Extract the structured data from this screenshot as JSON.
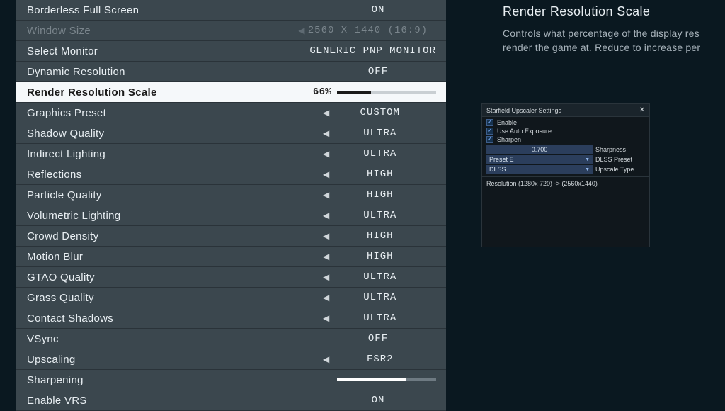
{
  "description": {
    "title": "Render Resolution Scale",
    "body": "Controls what percentage of the display res render the game at. Reduce to increase per"
  },
  "settings": [
    {
      "label": "Borderless Full Screen",
      "type": "simple",
      "value": "ON"
    },
    {
      "label": "Window Size",
      "type": "cycler",
      "value": "2560 X 1440 (16:9)",
      "disabled": true
    },
    {
      "label": "Select Monitor",
      "type": "simple",
      "value": "GENERIC PNP MONITOR"
    },
    {
      "label": "Dynamic Resolution",
      "type": "simple",
      "value": "OFF"
    },
    {
      "label": "Render Resolution Scale",
      "type": "slider",
      "value": "66%",
      "fill": 34,
      "highlighted": true
    },
    {
      "label": "Graphics Preset",
      "type": "cycler",
      "value": "CUSTOM"
    },
    {
      "label": "Shadow Quality",
      "type": "cycler",
      "value": "ULTRA"
    },
    {
      "label": "Indirect Lighting",
      "type": "cycler",
      "value": "ULTRA"
    },
    {
      "label": "Reflections",
      "type": "cycler",
      "value": "HIGH"
    },
    {
      "label": "Particle Quality",
      "type": "cycler",
      "value": "HIGH"
    },
    {
      "label": "Volumetric Lighting",
      "type": "cycler",
      "value": "ULTRA"
    },
    {
      "label": "Crowd Density",
      "type": "cycler",
      "value": "HIGH"
    },
    {
      "label": "Motion Blur",
      "type": "cycler",
      "value": "HIGH"
    },
    {
      "label": "GTAO Quality",
      "type": "cycler",
      "value": "ULTRA"
    },
    {
      "label": "Grass Quality",
      "type": "cycler",
      "value": "ULTRA"
    },
    {
      "label": "Contact Shadows",
      "type": "cycler",
      "value": "ULTRA"
    },
    {
      "label": "VSync",
      "type": "simple",
      "value": "OFF"
    },
    {
      "label": "Upscaling",
      "type": "cycler",
      "value": "FSR2"
    },
    {
      "label": "Sharpening",
      "type": "slider_light",
      "value": "",
      "fill": 70
    },
    {
      "label": "Enable VRS",
      "type": "simple",
      "value": "ON"
    }
  ],
  "overlay": {
    "title": "Starfield Upscaler Settings",
    "checks": [
      {
        "label": "Enable"
      },
      {
        "label": "Use Auto Exposure"
      },
      {
        "label": "Sharpen"
      }
    ],
    "sharpness_value": "0.700",
    "sharpness_label": "Sharpness",
    "preset_value": "Preset E",
    "preset_label": "DLSS Preset",
    "upscale_value": "DLSS",
    "upscale_label": "Upscale Type",
    "resolution_text": "Resolution (1280x 720) -> (2560x1440)"
  }
}
